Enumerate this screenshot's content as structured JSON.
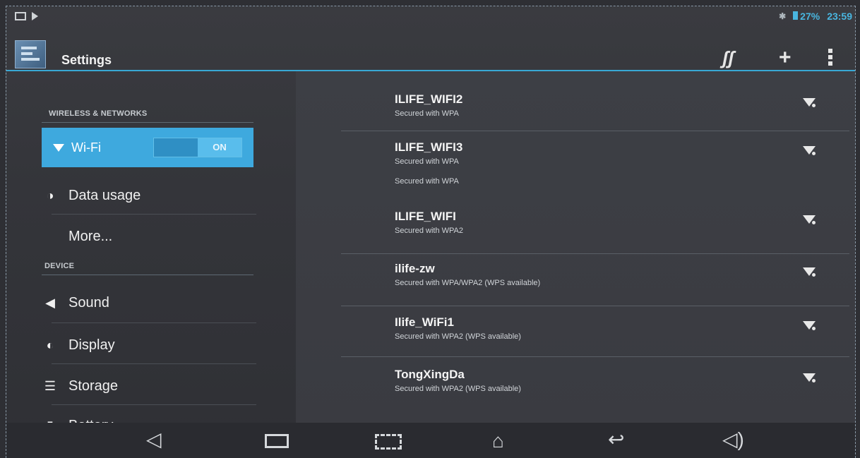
{
  "status": {
    "battery": "27%",
    "time": "23:59"
  },
  "actionbar": {
    "title": "Settings",
    "add_glyph": "+",
    "wps_glyph": "ʃʃ"
  },
  "sidebar": {
    "wireless_header": "WIRELESS & NETWORKS",
    "device_header": "DEVICE",
    "wifi_label": "Wi-Fi",
    "wifi_toggle_on": "ON",
    "items": [
      {
        "label": "Data usage",
        "icon": "pie-icon"
      },
      {
        "label": "More...",
        "icon": ""
      },
      {
        "label": "Sound",
        "icon": "speaker-icon"
      },
      {
        "label": "Display",
        "icon": "display-icon"
      },
      {
        "label": "Storage",
        "icon": "storage-icon"
      },
      {
        "label": "Battery",
        "icon": "battery-icon"
      }
    ]
  },
  "networks": [
    {
      "ssid": "ILIFE_WIFI2",
      "security": "Secured with WPA"
    },
    {
      "ssid": "ILIFE_WIFI3",
      "security": "Secured with WPA"
    },
    {
      "ssid": "ILIFE_WIFI",
      "security": "Secured with WPA2"
    },
    {
      "ssid": "ilife-zw",
      "security": "Secured with WPA/WPA2 (WPS available)"
    },
    {
      "ssid": "Ilife_WiFi1",
      "security": "Secured with WPA2 (WPS available)"
    },
    {
      "ssid": "TongXingDa",
      "security": "Secured with WPA2 (WPS available)"
    }
  ],
  "network_extra_security": "Secured with WPA",
  "colors": {
    "accent": "#3ea9de",
    "background": "#34353a"
  }
}
